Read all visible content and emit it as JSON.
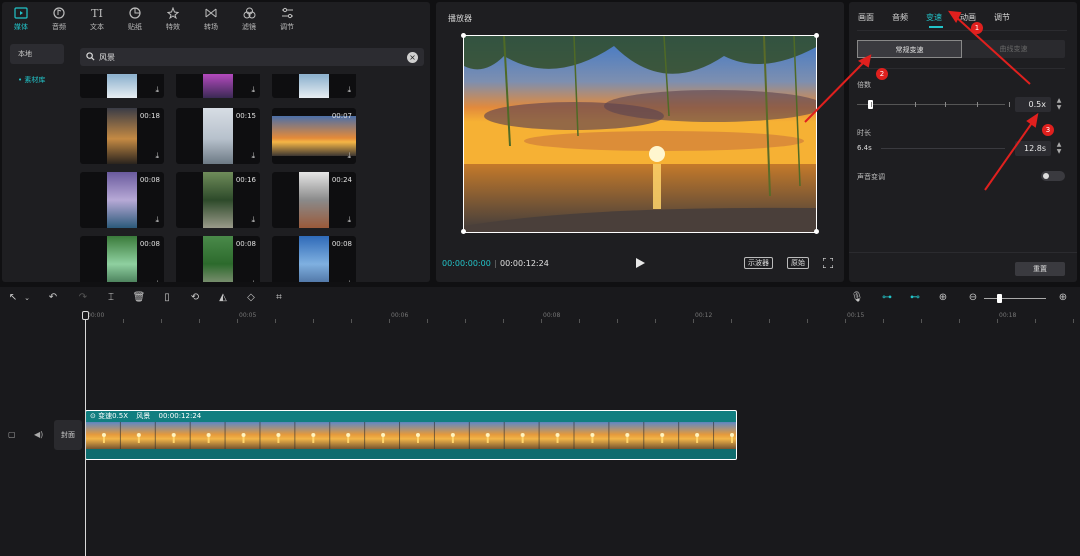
{
  "media": {
    "tabs": [
      {
        "label": "媒体",
        "icon": "media-icon",
        "active": true
      },
      {
        "label": "音频",
        "icon": "audio-icon"
      },
      {
        "label": "文本",
        "icon": "text-icon"
      },
      {
        "label": "贴纸",
        "icon": "sticker-icon"
      },
      {
        "label": "特效",
        "icon": "effects-icon"
      },
      {
        "label": "转场",
        "icon": "transition-icon"
      },
      {
        "label": "滤镜",
        "icon": "filter-icon"
      },
      {
        "label": "调节",
        "icon": "adjust-icon"
      }
    ],
    "side_items": [
      "本地",
      "• 素材库"
    ],
    "search_value": "风景",
    "thumbs": [
      {
        "dur": "",
        "scene": "snow"
      },
      {
        "dur": "",
        "scene": "flowers"
      },
      {
        "dur": "",
        "scene": "snow"
      },
      {
        "dur": "00:18",
        "scene": "reed-sunset"
      },
      {
        "dur": "00:15",
        "scene": "mountain"
      },
      {
        "dur": "00:07",
        "scene": "sunset"
      },
      {
        "dur": "00:08",
        "scene": "lake"
      },
      {
        "dur": "00:16",
        "scene": "forest-path"
      },
      {
        "dur": "00:24",
        "scene": "winter-trees"
      },
      {
        "dur": "00:08",
        "scene": "waterfall"
      },
      {
        "dur": "00:08",
        "scene": "village"
      },
      {
        "dur": "00:08",
        "scene": "blue-sky"
      }
    ]
  },
  "player": {
    "title": "播放器",
    "current_time": "00:00:00:00",
    "total_time": "00:00:12:24",
    "btn_scope": "示波器",
    "btn_original": "原始"
  },
  "props": {
    "tabs": [
      "画面",
      "音频",
      "变速",
      "动画",
      "调节"
    ],
    "active_tab": 2,
    "seg_normal": "常规变速",
    "seg_curve": "曲线变速",
    "multiplier_label": "倍数",
    "multiplier_value": "0.5x",
    "multiplier_fraction": 0.05,
    "duration_label": "时长",
    "duration_original": "6.4s",
    "duration_value": "12.8s",
    "pitch_label": "声音变调",
    "reset_label": "重置",
    "badges": [
      "1",
      "2",
      "3"
    ]
  },
  "timeline": {
    "ruler": [
      "00:00",
      "00:05",
      "00:06",
      "00:08",
      "00:12",
      "00:15",
      "00:18"
    ],
    "cover_label": "封面",
    "clip_speed": "变速0.5X",
    "clip_name": "风景",
    "clip_duration": "00:00:12:24"
  },
  "colors": {
    "accent": "#22c4c9",
    "clip": "#117e80",
    "annotation": "#e0201e"
  }
}
